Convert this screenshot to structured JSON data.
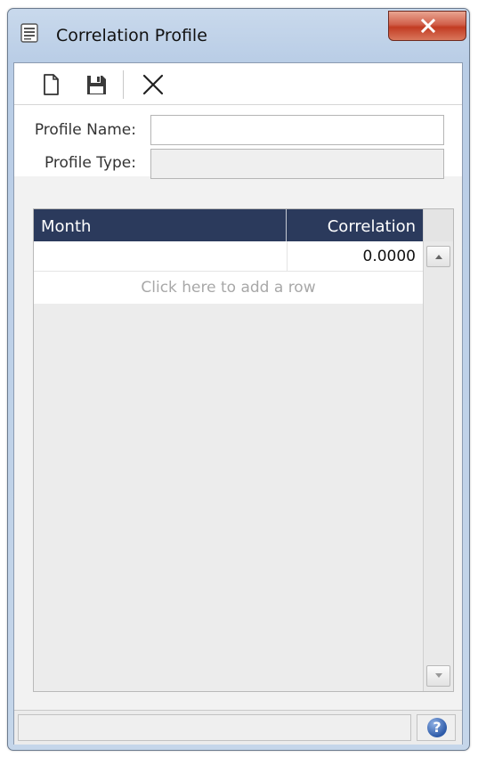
{
  "window": {
    "title": "Correlation Profile",
    "close_label": "X"
  },
  "toolbar": {
    "new_icon": "new-document-icon",
    "save_icon": "save-icon",
    "delete_icon": "delete-x-icon"
  },
  "form": {
    "profile_name_label": "Profile Name:",
    "profile_name_value": "",
    "profile_type_label": "Profile Type:",
    "profile_type_value": ""
  },
  "grid": {
    "columns": [
      "Month",
      "Correlation"
    ],
    "rows": [
      {
        "month": "",
        "correlation": "0.0000"
      }
    ],
    "add_row_text": "Click here to add a row"
  },
  "statusbar": {
    "text": "",
    "help_label": "?"
  },
  "colors": {
    "grid_header_bg": "#2b3a5c",
    "close_button": "#c23b22",
    "help_icon": "#2d5aa8"
  }
}
